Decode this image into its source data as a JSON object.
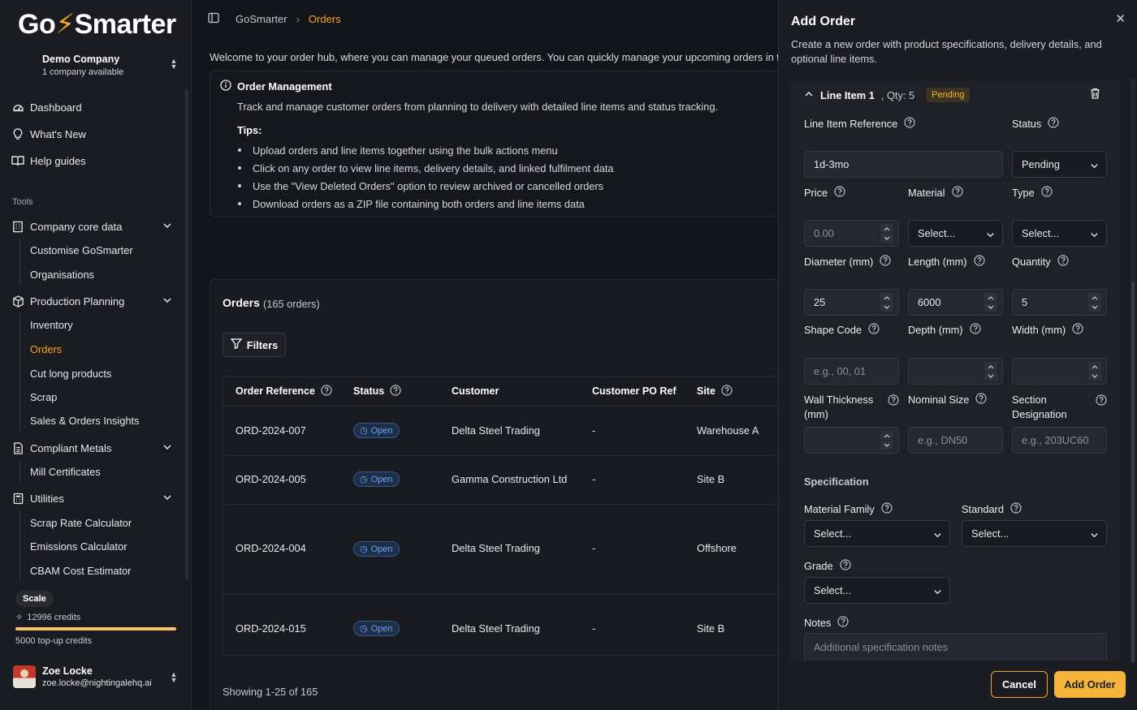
{
  "brand": {
    "logo_text_a": "Go",
    "logo_text_b": "Smarter",
    "accent": "#f5a623"
  },
  "company": {
    "name": "Demo Company",
    "sub": "1 company available"
  },
  "nav": {
    "dashboard": "Dashboard",
    "whats_new": "What's New",
    "help_guides": "Help guides",
    "tools_label": "Tools",
    "company_core": "Company core data",
    "company_core_items": [
      "Customise GoSmarter",
      "Organisations"
    ],
    "production": "Production Planning",
    "production_items": [
      "Inventory",
      "Orders",
      "Cut long products",
      "Scrap",
      "Sales & Orders Insights"
    ],
    "compliant": "Compliant Metals",
    "compliant_items": [
      "Mill Certificates"
    ],
    "utilities": "Utilities",
    "utilities_items": [
      "Scrap Rate Calculator",
      "Emissions Calculator",
      "CBAM Cost Estimator"
    ]
  },
  "plan": {
    "badge": "Scale",
    "credits": "12996 credits",
    "topup": "5000 top-up credits",
    "credit_fill": 1.0
  },
  "user": {
    "name": "Zoe Locke",
    "email": "zoe.locke@nightingalehq.ai"
  },
  "breadcrumb": {
    "root": "GoSmarter",
    "current": "Orders"
  },
  "welcome": "Welcome to your order hub, where you can manage your queued orders. You can quickly manage your upcoming orders in t",
  "info": {
    "title": "Order Management",
    "desc": "Track and manage customer orders from planning to delivery with detailed line items and status tracking.",
    "tips_label": "Tips:",
    "tips": [
      "Upload orders and line items together using the bulk actions menu",
      "Click on any order to view line items, delivery details, and linked fulfilment data",
      "Use the \"View Deleted Orders\" option to review archived or cancelled orders",
      "Download orders as a ZIP file containing both orders and line items data"
    ]
  },
  "orders": {
    "title": "Orders",
    "count": "(165 orders)",
    "filters": "Filters",
    "columns": [
      "Order Reference",
      "Status",
      "Customer",
      "Customer PO Ref",
      "Site"
    ],
    "rows": [
      {
        "ref": "ORD-2024-007",
        "status": "Open",
        "customer": "Delta Steel Trading",
        "po": "-",
        "site": "Warehouse A"
      },
      {
        "ref": "ORD-2024-005",
        "status": "Open",
        "customer": "Gamma Construction Ltd",
        "po": "-",
        "site": "Site B"
      },
      {
        "ref": "ORD-2024-004",
        "status": "Open",
        "customer": "Delta Steel Trading",
        "po": "-",
        "site": "Offshore"
      },
      {
        "ref": "ORD-2024-015",
        "status": "Open",
        "customer": "Delta Steel Trading",
        "po": "-",
        "site": "Site B"
      }
    ],
    "showing": "Showing 1-25 of 165"
  },
  "drawer": {
    "title": "Add Order",
    "desc": "Create a new order with product specifications, delivery details, and optional line items.",
    "line_item": {
      "title": "Line Item 1",
      "qty": ", Qty: 5",
      "badge": "Pending"
    },
    "labels": {
      "ref": "Line Item Reference",
      "status": "Status",
      "price": "Price",
      "material": "Material",
      "type": "Type",
      "diameter": "Diameter (mm)",
      "length": "Length (mm)",
      "quantity": "Quantity",
      "shape": "Shape Code",
      "depth": "Depth (mm)",
      "width": "Width (mm)",
      "wall": "Wall Thickness (mm)",
      "nominal": "Nominal Size",
      "section": "Section Designation",
      "spec": "Specification",
      "family": "Material Family",
      "standard": "Standard",
      "grade": "Grade",
      "notes": "Notes"
    },
    "values": {
      "ref": "1d-3mo",
      "status": "Pending",
      "price": "0.00",
      "material": "Select...",
      "type": "Select...",
      "diameter": "25",
      "length": "6000",
      "quantity": "5",
      "family": "Select...",
      "standard": "Select...",
      "grade": "Select..."
    },
    "placeholders": {
      "shape": "e.g., 00, 01",
      "nominal": "e.g., DN50",
      "section": "e.g., 203UC60",
      "notes": "Additional specification notes"
    },
    "cancel": "Cancel",
    "add": "Add Order"
  }
}
